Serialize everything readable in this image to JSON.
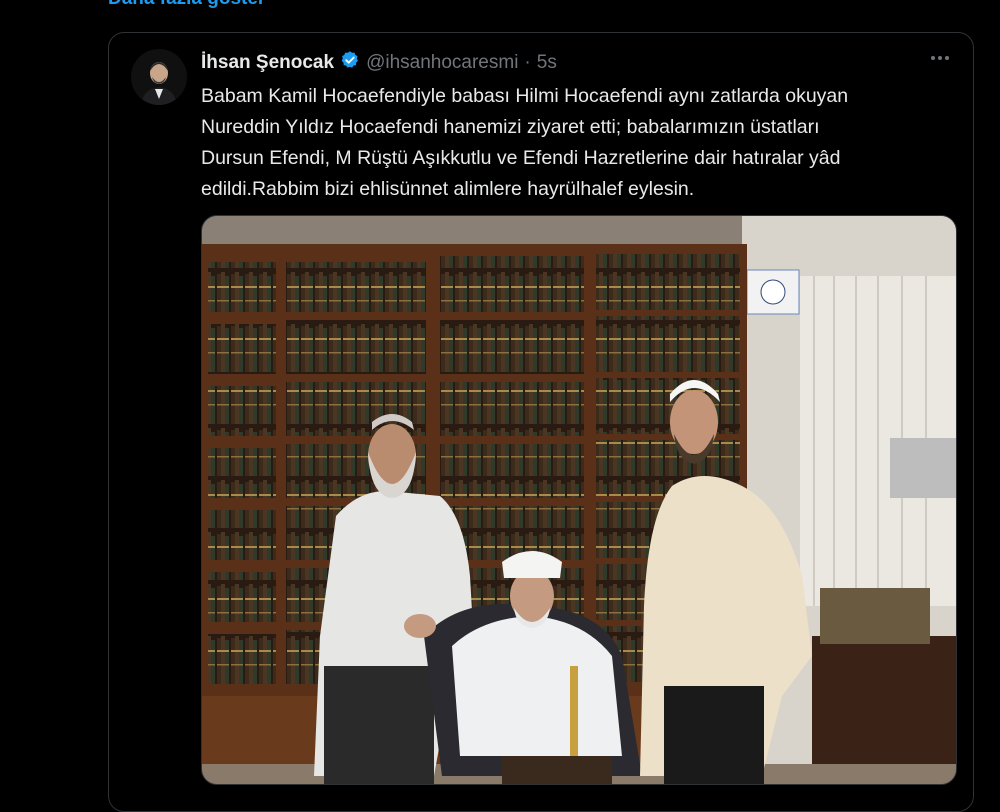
{
  "show_more": "Daha fazla göster",
  "tweet": {
    "author_name": "İhsan Şenocak",
    "handle": "@ihsanhocaresmi",
    "separator": "·",
    "time": "5s",
    "text_lines": [
      "Babam Kamil Hocaefendiyle babası Hilmi Hocaefendi aynı zatlarda okuyan",
      "Nureddin Yıldız Hocaefendi hanemizi ziyaret etti; babalarımızın üstatları",
      "Dursun Efendi, M Rüştü Aşıkkutlu ve Efendi Hazretlerine dair hatıralar yâd",
      "edildi.Rabbim bizi ehlisünnet alimlere hayrülhalef eylesin."
    ],
    "more_icon": "more-horizontal-icon",
    "verified_icon": "verified-badge-icon"
  },
  "colors": {
    "background": "#000000",
    "text": "#e7e9ea",
    "secondary_text": "#71767b",
    "link": "#1d9bf0",
    "border": "#2f3336"
  }
}
